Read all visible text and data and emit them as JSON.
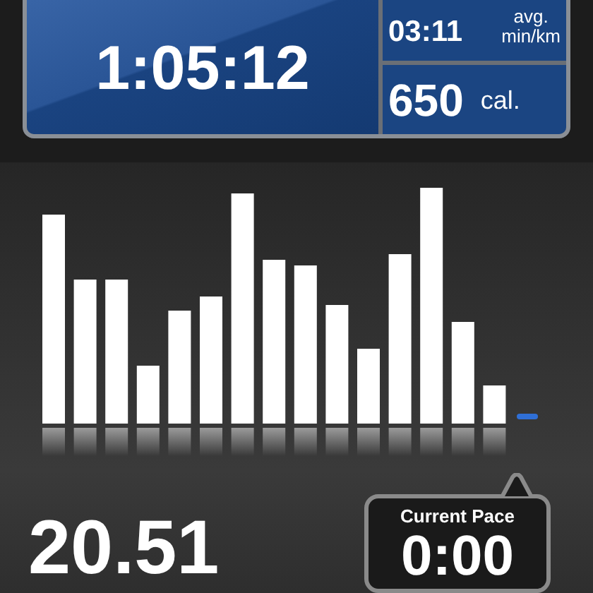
{
  "stats": {
    "duration": "1:05:12",
    "pace": {
      "value": "03:11",
      "label_top": "avg.",
      "label_bottom": "min/km"
    },
    "calories": {
      "value": "650",
      "unit": "cal."
    }
  },
  "distance": "20.51",
  "current_pace": {
    "label": "Current Pace",
    "value": "0:00"
  }
}
